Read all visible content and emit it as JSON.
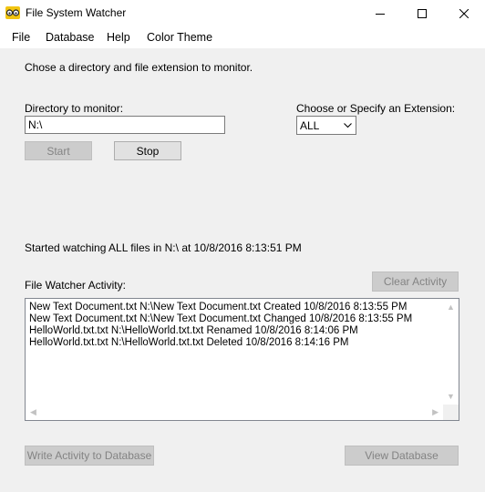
{
  "window": {
    "title": "File System Watcher"
  },
  "menu": {
    "items": [
      "File",
      "Database",
      "Help",
      "Color Theme"
    ]
  },
  "instructions": "Chose a directory and file extension to monitor.",
  "directory": {
    "label": "Directory to monitor:",
    "value": "N:\\"
  },
  "extension": {
    "label": "Choose or Specify an Extension:",
    "value": "ALL"
  },
  "buttons": {
    "start": "Start",
    "stop": "Stop",
    "clear": "Clear Activity",
    "write_db": "Write Activity to Database",
    "view_db": "View Database"
  },
  "status": "Started watching ALL files in N:\\ at 10/8/2016 8:13:51 PM",
  "activity": {
    "label": "File Watcher Activity:",
    "lines": [
      "New Text Document.txt N:\\New Text Document.txt Created 10/8/2016 8:13:55 PM",
      "New Text Document.txt N:\\New Text Document.txt Changed 10/8/2016 8:13:55 PM",
      "HelloWorld.txt.txt N:\\HelloWorld.txt.txt Renamed 10/8/2016 8:14:06 PM",
      "HelloWorld.txt.txt N:\\HelloWorld.txt.txt Deleted 10/8/2016 8:14:16 PM"
    ]
  },
  "icons": {
    "app": "glasses-icon",
    "minimize": "minimize-icon",
    "maximize": "maximize-icon",
    "close": "close-icon",
    "dropdown": "chevron-down-icon"
  },
  "colors": {
    "background": "#f0f0f0",
    "app_icon": "#f2c511",
    "disabled_text": "#838383"
  }
}
